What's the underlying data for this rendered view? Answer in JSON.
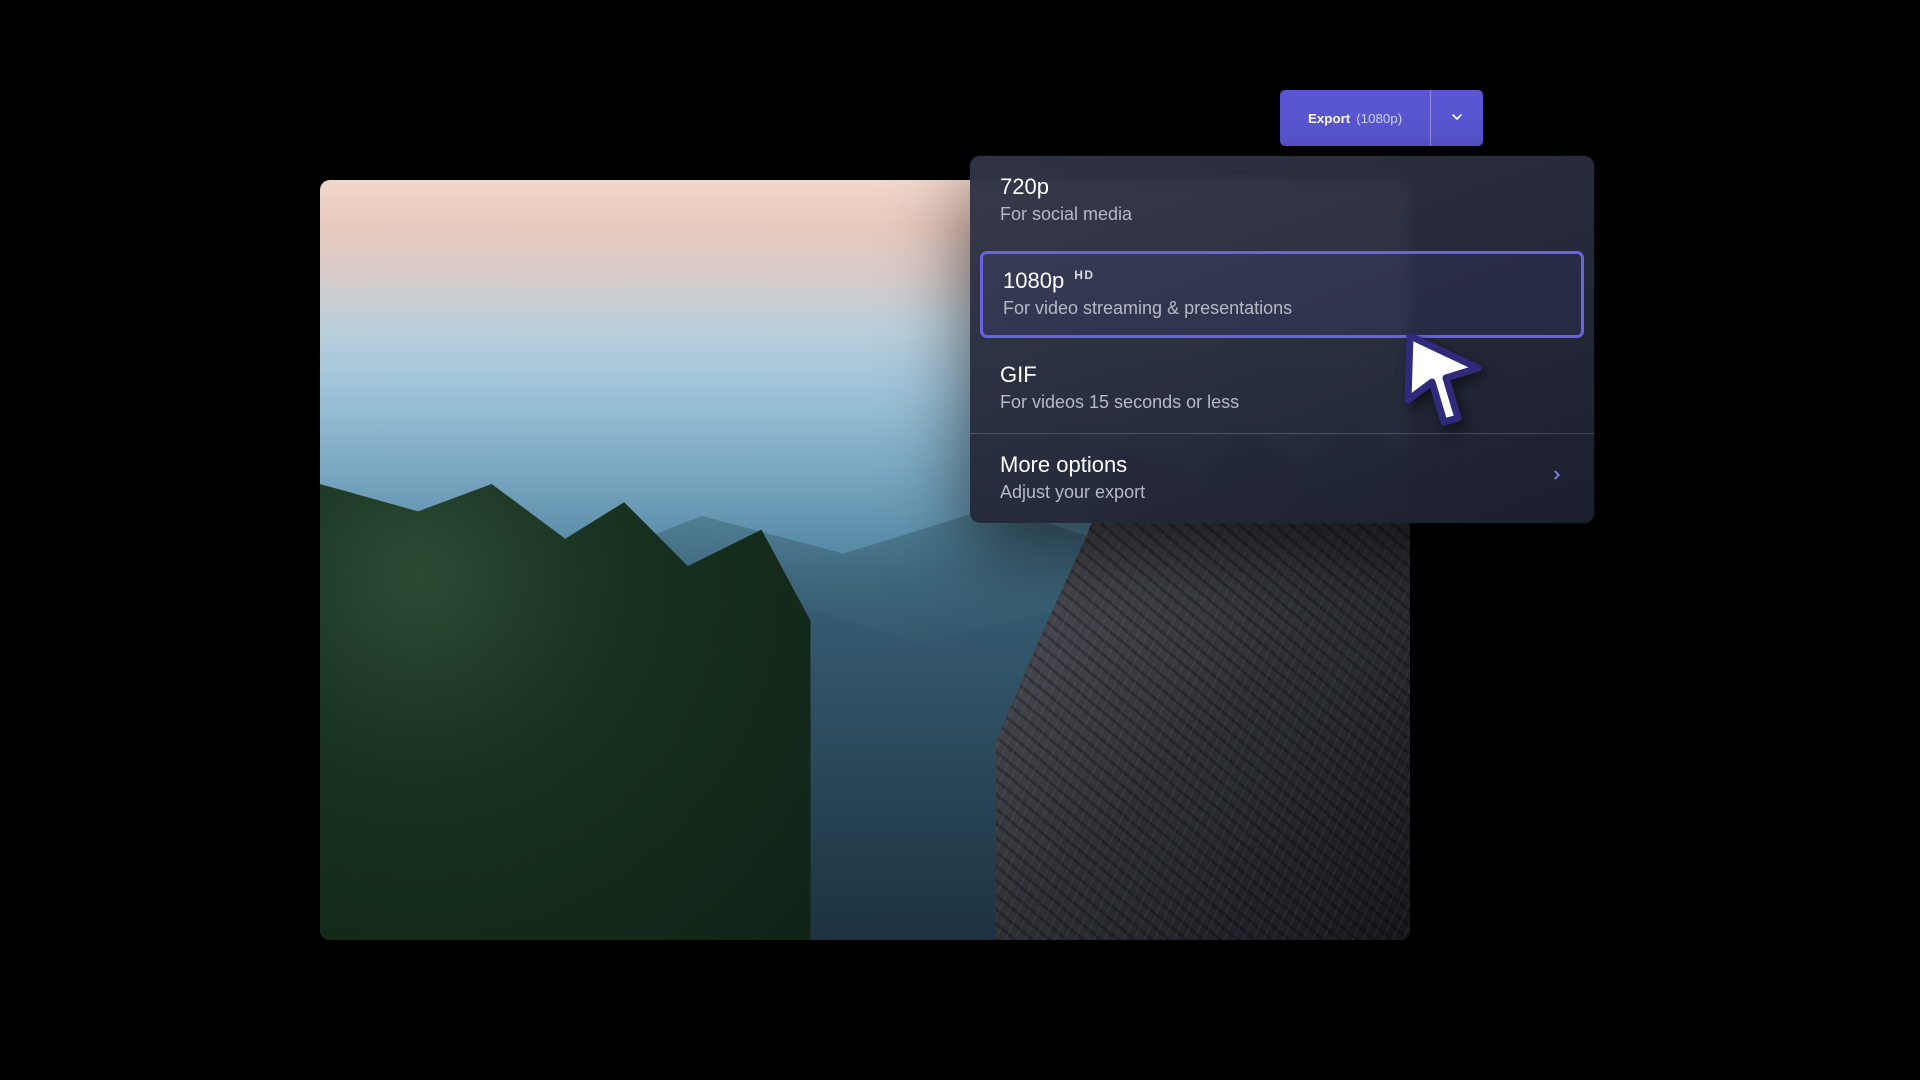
{
  "export_button": {
    "label": "Export",
    "current_resolution": "(1080p)"
  },
  "dropdown": {
    "items": [
      {
        "title": "720p",
        "subtitle": "For social media",
        "selected": false,
        "badge": ""
      },
      {
        "title": "1080p",
        "subtitle": "For video streaming & presentations",
        "selected": true,
        "badge": "HD"
      },
      {
        "title": "GIF",
        "subtitle": "For videos 15 seconds or less",
        "selected": false,
        "badge": ""
      }
    ],
    "more": {
      "title": "More options",
      "subtitle": "Adjust your export"
    }
  },
  "colors": {
    "accent": "#5b57d4",
    "accent_border": "#6763e3"
  }
}
